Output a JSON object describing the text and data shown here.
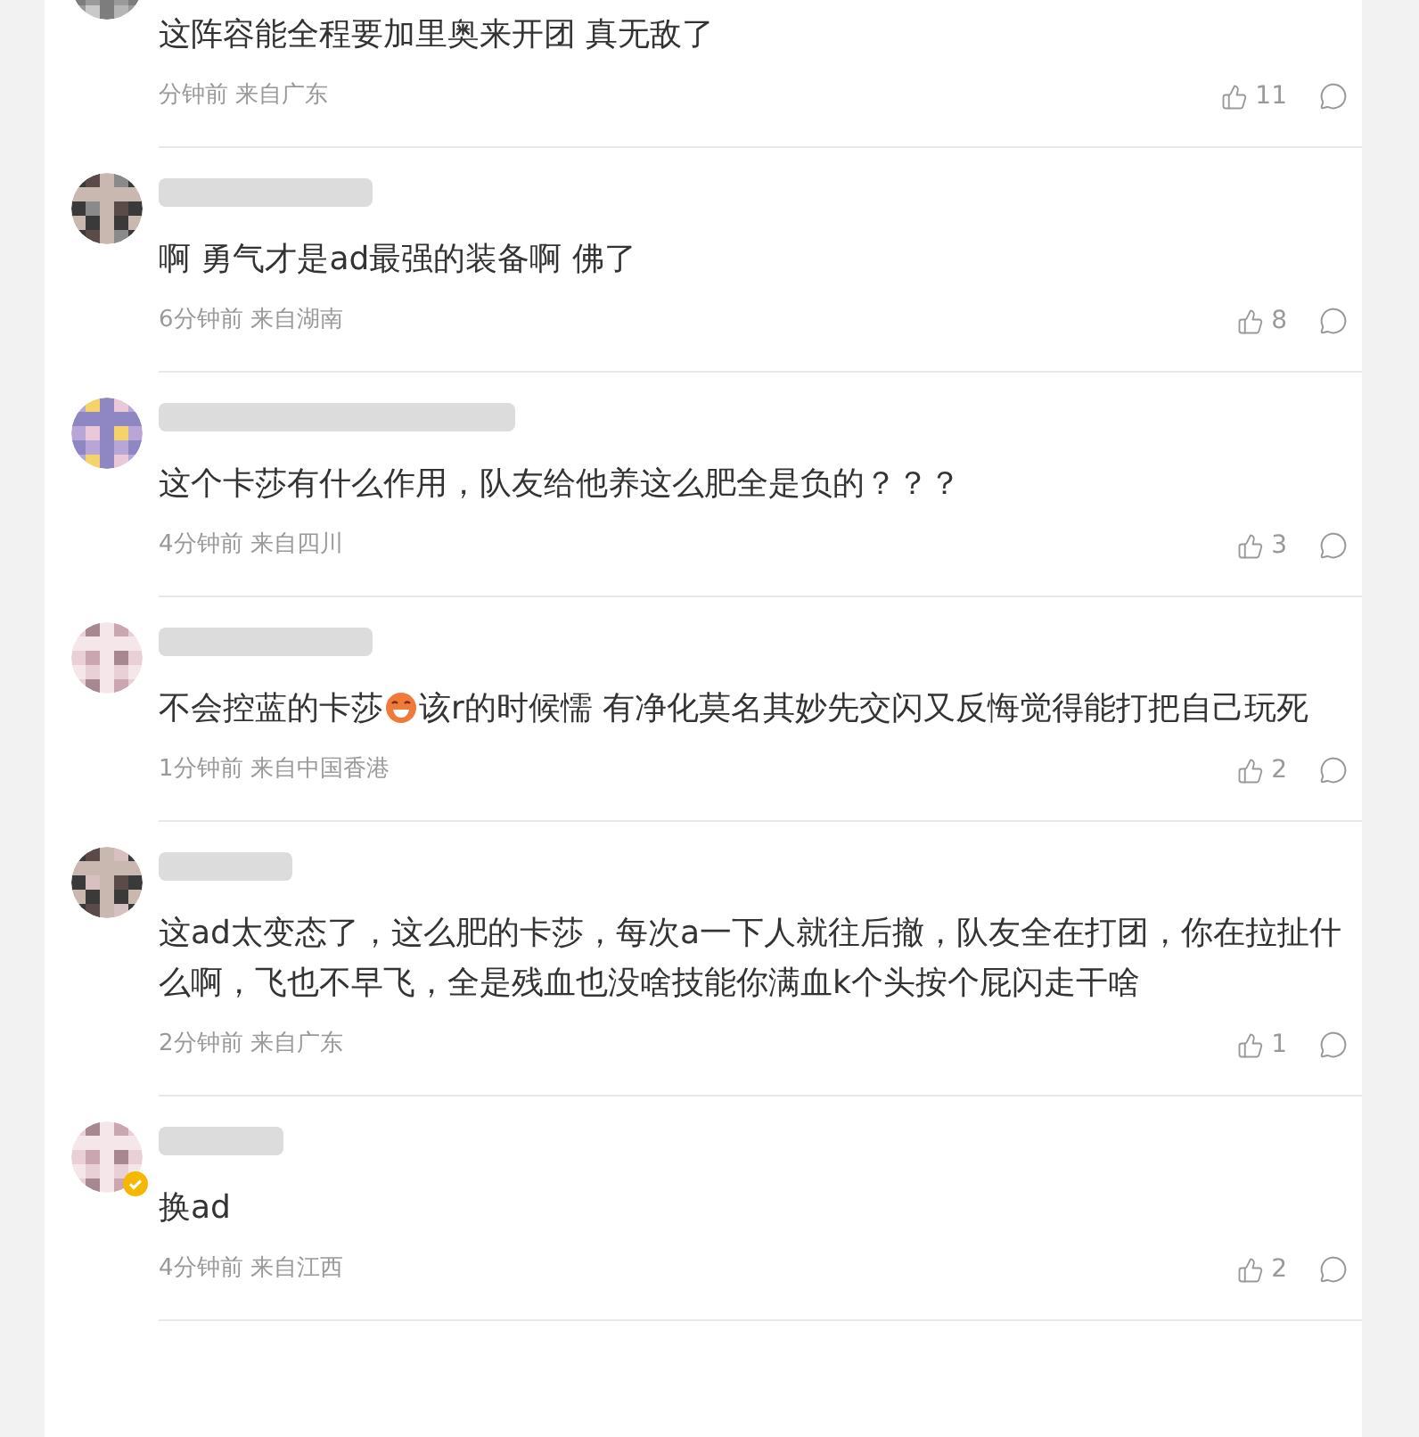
{
  "comments": [
    {
      "verified": false,
      "content": [
        {
          "kind": "text",
          "text": "这阵容能全程要加里奥来开团 真无敌了"
        }
      ],
      "time": "分钟前 来自广东",
      "likes": "11"
    },
    {
      "verified": false,
      "content": [
        {
          "kind": "text",
          "text": "啊 勇气才是ad最强的装备啊 佛了"
        }
      ],
      "time": "6分钟前 来自湖南",
      "likes": "8"
    },
    {
      "verified": false,
      "content": [
        {
          "kind": "text",
          "text": "这个卡莎有什么作用，队友给他养这么肥全是负的？？？"
        }
      ],
      "time": "4分钟前 来自四川",
      "likes": "3"
    },
    {
      "verified": false,
      "content": [
        {
          "kind": "text",
          "text": "不会控蓝的卡莎"
        },
        {
          "kind": "emoji"
        },
        {
          "kind": "text",
          "text": "该r的时候懦 有净化莫名其妙先交闪又反悔觉得能打把自己玩死"
        }
      ],
      "time": "1分钟前 来自中国香港",
      "likes": "2"
    },
    {
      "verified": false,
      "content": [
        {
          "kind": "text",
          "text": "这ad太变态了，这么肥的卡莎，每次a一下人就往后撤，队友全在打团，你在拉扯什么啊，飞也不早飞，全是残血也没啥技能你满血k个头按个屁闪走干啥"
        }
      ],
      "time": "2分钟前 来自广东",
      "likes": "1"
    },
    {
      "verified": true,
      "content": [
        {
          "kind": "text",
          "text": "换ad"
        }
      ],
      "time": "4分钟前 来自江西",
      "likes": "2"
    }
  ]
}
